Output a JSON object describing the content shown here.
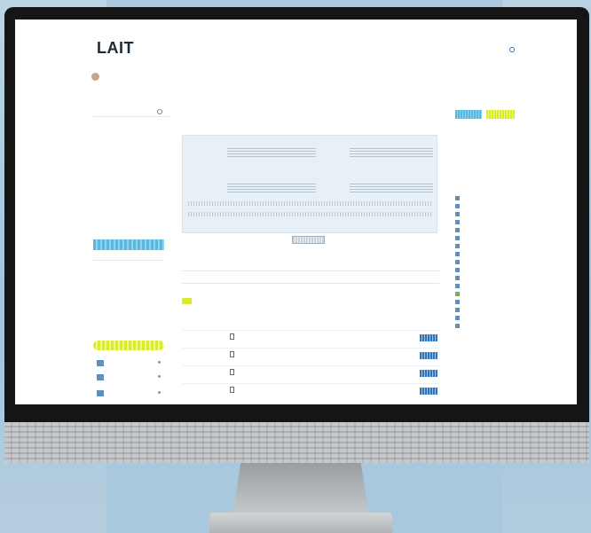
{
  "colors": {
    "accent_blue": "#55b9e0",
    "accent_yellow": "#d8ec2a",
    "link_blue": "#2f73b8",
    "bezel": "#151515"
  },
  "app": {
    "logo": "LAIT",
    "tagline": "",
    "top_link": "",
    "top_user": ""
  },
  "profile": {
    "name": "",
    "role": "",
    "notify": ""
  },
  "sidebar": {
    "search_label": "",
    "items": [
      {
        "label": "",
        "arrow": ""
      },
      {
        "label": "",
        "arrow": ""
      },
      {
        "label": "",
        "arrow": ""
      },
      {
        "label": "",
        "arrow": ""
      },
      {
        "label": "",
        "arrow": ""
      },
      {
        "label": "",
        "arrow": ""
      },
      {
        "label": "",
        "arrow": ""
      },
      {
        "label": "",
        "arrow": ""
      },
      {
        "label": "",
        "arrow": ""
      }
    ],
    "active_item": "",
    "tab_label": "",
    "more_items": [
      {
        "label": "",
        "arrow": ""
      },
      {
        "label": "",
        "arrow": ""
      },
      {
        "label": "",
        "arrow": ""
      }
    ],
    "section_label": "",
    "yellow_button": "",
    "mini_items": [
      {
        "label": ""
      },
      {
        "label": ""
      },
      {
        "label": ""
      }
    ]
  },
  "main": {
    "doc_title": "",
    "doc_sub": "",
    "info_cells": [
      {
        "label": "",
        "value": ""
      },
      {
        "label": "",
        "value": ""
      },
      {
        "label": "",
        "value": ""
      },
      {
        "label": "",
        "value": ""
      }
    ],
    "info_footer": "",
    "info_footer_right": "",
    "tabs": [
      {
        "label": ""
      },
      {
        "label": ""
      },
      {
        "label": ""
      },
      {
        "label": ""
      },
      {
        "label": ""
      },
      {
        "label": ""
      },
      {
        "label": ""
      }
    ],
    "subtabs": "",
    "filter_placeholder": "",
    "green_row_text": "",
    "more_link": "",
    "table": {
      "headers": [
        "",
        "",
        "",
        ""
      ],
      "rows": [
        {
          "type": "",
          "title": "",
          "detail": "",
          "date": ""
        },
        {
          "type": "",
          "title": "",
          "detail": "",
          "date": ""
        },
        {
          "type": "",
          "title": "",
          "detail": "",
          "date": ""
        },
        {
          "type": "",
          "title": "",
          "detail": "",
          "date": ""
        }
      ]
    }
  },
  "right": {
    "head1": "",
    "kv": [
      {
        "k": "",
        "v": ""
      },
      {
        "k": "",
        "v": ""
      }
    ],
    "head2": "",
    "items": [
      {
        "label": ""
      },
      {
        "label": ""
      },
      {
        "label": ""
      },
      {
        "label": ""
      },
      {
        "label": ""
      },
      {
        "label": ""
      },
      {
        "label": ""
      },
      {
        "label": ""
      },
      {
        "label": ""
      },
      {
        "label": ""
      },
      {
        "label": ""
      },
      {
        "label": ""
      },
      {
        "label": ""
      },
      {
        "label": ""
      },
      {
        "label": ""
      },
      {
        "label": ""
      },
      {
        "label": ""
      }
    ]
  }
}
